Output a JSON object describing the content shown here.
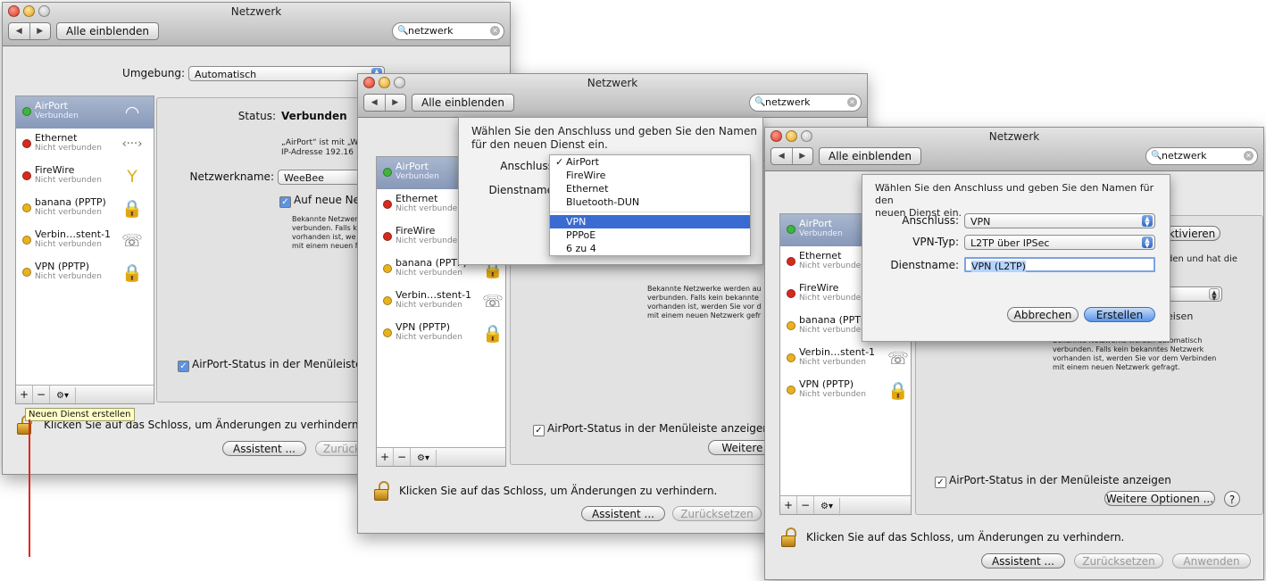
{
  "w1": {
    "title": "Netzwerk",
    "show_all": "Alle einblenden",
    "search": "netzwerk",
    "location_label": "Umgebung:",
    "location_value": "Automatisch",
    "services": [
      {
        "name": "AirPort",
        "status": "Verbunden",
        "dot": "g"
      },
      {
        "name": "Ethernet",
        "status": "Nicht verbunden",
        "dot": "r"
      },
      {
        "name": "FireWire",
        "status": "Nicht verbunden",
        "dot": "r"
      },
      {
        "name": "banana (PPTP)",
        "status": "Nicht verbunden",
        "dot": "y"
      },
      {
        "name": "Verbin…stent-1",
        "status": "Nicht verbunden",
        "dot": "y"
      },
      {
        "name": "VPN (PPTP)",
        "status": "Nicht verbunden",
        "dot": "y"
      }
    ],
    "status_label": "Status:",
    "status_value": "Verbunden",
    "status_desc_1": "„AirPort“ ist mit „We",
    "status_desc_2": "IP-Adresse 192.16",
    "netname_label": "Netzwerkname:",
    "netname_value": "WeeBee",
    "ask_new": "Auf neue Net",
    "known_text_1": "Bekannte Netzwer",
    "known_text_2": "verbunden. Falls k",
    "known_text_3": "vorhanden ist, we",
    "known_text_4": "mit einem neuen N",
    "menubar_status": "AirPort-Status in der Menüleiste an",
    "tooltip": "Neuen Dienst erstellen",
    "lock_text": "Klicken Sie auf das Schloss, um Änderungen zu verhindern.",
    "assistant": "Assistent ...",
    "reset": "Zurück"
  },
  "w2": {
    "title": "Netzwerk",
    "show_all": "Alle einblenden",
    "search": "netzwerk",
    "sheet_text": "Wählen Sie den Anschluss und geben Sie den Namen für den neuen Dienst ein.",
    "port_label": "Anschluss",
    "name_label": "Dienstname",
    "menu_items": [
      "AirPort",
      "FireWire",
      "Ethernet",
      "Bluetooth-DUN",
      "VPN",
      "PPPoE",
      "6 zu 4"
    ],
    "services": [
      {
        "name": "AirPort",
        "status": "Verbunden",
        "dot": "g"
      },
      {
        "name": "Ethernet",
        "status": "Nicht verbunden",
        "dot": "r"
      },
      {
        "name": "FireWire",
        "status": "Nicht verbunden",
        "dot": "r"
      },
      {
        "name": "banana (PPTP)",
        "status": "Nicht verbunden",
        "dot": "y"
      },
      {
        "name": "Verbin…stent-1",
        "status": "Nicht verbunden",
        "dot": "y"
      },
      {
        "name": "VPN (PPTP)",
        "status": "Nicht verbunden",
        "dot": "y"
      }
    ],
    "known_text_1": "Bekannte Netzwerke werden au",
    "known_text_2": "verbunden. Falls kein bekannte",
    "known_text_3": "vorhanden ist, werden Sie vor d",
    "known_text_4": "mit einem neuen Netzwerk gefr",
    "menubar_status": "AirPort-Status in der Menüleiste anzeigen",
    "more_options": "Weitere O",
    "lock_text": "Klicken Sie auf das Schloss, um Änderungen zu verhindern.",
    "assistant": "Assistent ...",
    "reset": "Zurücksetzen"
  },
  "w3": {
    "title": "Netzwerk",
    "show_all": "Alle einblenden",
    "search": "netzwerk",
    "sheet_text_1": "Wählen Sie den Anschluss und geben Sie den Namen für den",
    "sheet_text_2": "neuen Dienst ein.",
    "port_label": "Anschluss:",
    "port_value": "VPN",
    "vpntype_label": "VPN-Typ:",
    "vpntype_value": "L2TP über IPSec",
    "name_label": "Dienstname:",
    "name_value": "VPN (L2TP)",
    "cancel": "Abbrechen",
    "create": "Erstellen",
    "deactivate_partial": "ktivieren",
    "partial_text": "den und hat die",
    "partial_text2": "eisen",
    "services": [
      {
        "name": "AirPort",
        "status": "Verbunden",
        "dot": "g"
      },
      {
        "name": "Ethernet",
        "status": "Nicht verbunden",
        "dot": "r"
      },
      {
        "name": "FireWire",
        "status": "Nicht verbunden",
        "dot": "r"
      },
      {
        "name": "banana (PPTP",
        "status": "Nicht verbunden",
        "dot": "y"
      },
      {
        "name": "Verbin…stent-1",
        "status": "Nicht verbunden",
        "dot": "y"
      },
      {
        "name": "VPN (PPTP)",
        "status": "Nicht verbunden",
        "dot": "y"
      }
    ],
    "known_text_1": "Bekannte Netzwerke werden automatisch",
    "known_text_2": "verbunden. Falls kein bekanntes Netzwerk",
    "known_text_3": "vorhanden ist, werden Sie vor dem Verbinden",
    "known_text_4": "mit einem neuen Netzwerk gefragt.",
    "menubar_status": "AirPort-Status in der Menüleiste anzeigen",
    "more_options": "Weitere Optionen ...",
    "lock_text": "Klicken Sie auf das Schloss, um Änderungen zu verhindern.",
    "assistant": "Assistent ...",
    "reset": "Zurücksetzen",
    "apply": "Anwenden"
  },
  "icons": [
    "wifi-icon",
    "ethernet-icon",
    "firewire-icon",
    "vpn-lock-icon",
    "phone-modem-icon",
    "vpn-lock-icon"
  ],
  "colors": {
    "selection": "#8799b9",
    "menu_highlight": "#3a6bd2",
    "annotation_line": "#e0281b"
  }
}
